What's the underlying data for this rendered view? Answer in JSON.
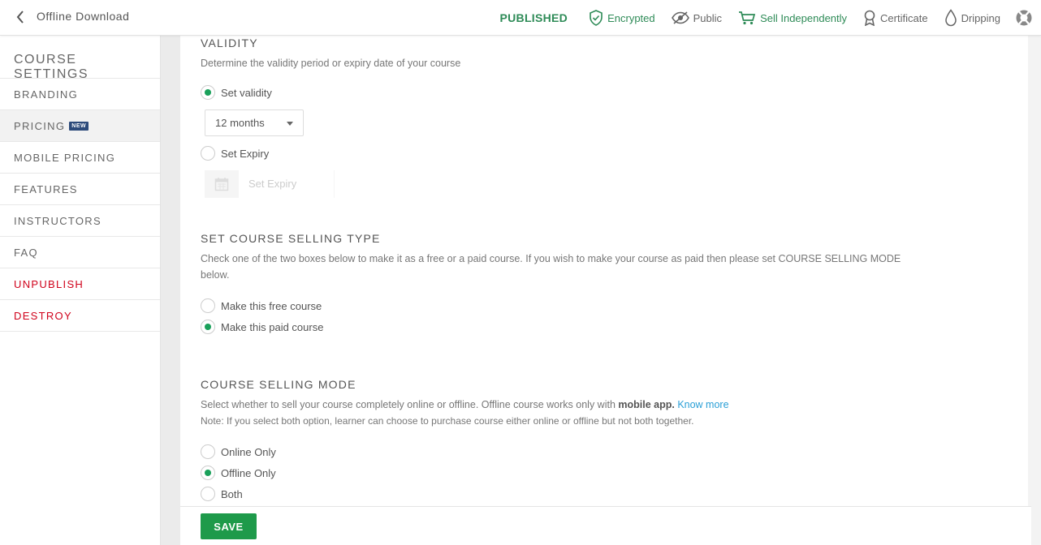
{
  "header": {
    "title": "Offline Download",
    "published": "PUBLISHED",
    "stats": [
      {
        "label": "Encrypted",
        "icon": "shield-check-icon"
      },
      {
        "label": "Public",
        "icon": "eye-slash-icon"
      },
      {
        "label": "Sell Independently",
        "icon": "cart-icon"
      },
      {
        "label": "Certificate",
        "icon": "ribbon-icon"
      },
      {
        "label": "Dripping",
        "icon": "drop-icon"
      }
    ]
  },
  "sidebar": {
    "heading": "COURSE SETTINGS",
    "items": [
      {
        "label": "BRANDING"
      },
      {
        "label": "PRICING",
        "badge": "NEW"
      },
      {
        "label": "MOBILE PRICING"
      },
      {
        "label": "FEATURES"
      },
      {
        "label": "INSTRUCTORS"
      },
      {
        "label": "FAQ"
      },
      {
        "label": "UNPUBLISH"
      },
      {
        "label": "DESTROY"
      }
    ]
  },
  "validity": {
    "title": "VALIDITY",
    "description": "Determine the validity period or expiry date of your course",
    "set_validity_label": "Set validity",
    "set_validity_checked": true,
    "validity_value": "12 months",
    "set_expiry_label": "Set Expiry",
    "set_expiry_checked": false,
    "expiry_placeholder": "Set Expiry"
  },
  "selling_type": {
    "title": "SET COURSE SELLING TYPE",
    "description": "Check one of the two boxes below to make it as a free or a paid course. If you wish to make your course as paid then please set COURSE SELLING MODE below.",
    "options": [
      {
        "label": "Make this free course",
        "checked": false
      },
      {
        "label": "Make this paid course",
        "checked": true
      }
    ]
  },
  "selling_mode": {
    "title": "COURSE SELLING MODE",
    "description_pre": "Select whether to sell your course completely online or offline. Offline course works only with ",
    "description_bold": "mobile app.",
    "know_more": "Know more",
    "note": "Note: If you select both option, learner can choose to purchase course either online or offline but not both together.",
    "options": [
      {
        "label": "Online Only",
        "checked": false
      },
      {
        "label": "Offline Only",
        "checked": true
      },
      {
        "label": "Both",
        "checked": false
      }
    ]
  },
  "footer": {
    "save_label": "SAVE"
  },
  "colors": {
    "accent_green": "#1e9a4a",
    "published_green": "#2e8b57",
    "danger_red": "#d0021b",
    "link_blue": "#2a9fd6"
  }
}
